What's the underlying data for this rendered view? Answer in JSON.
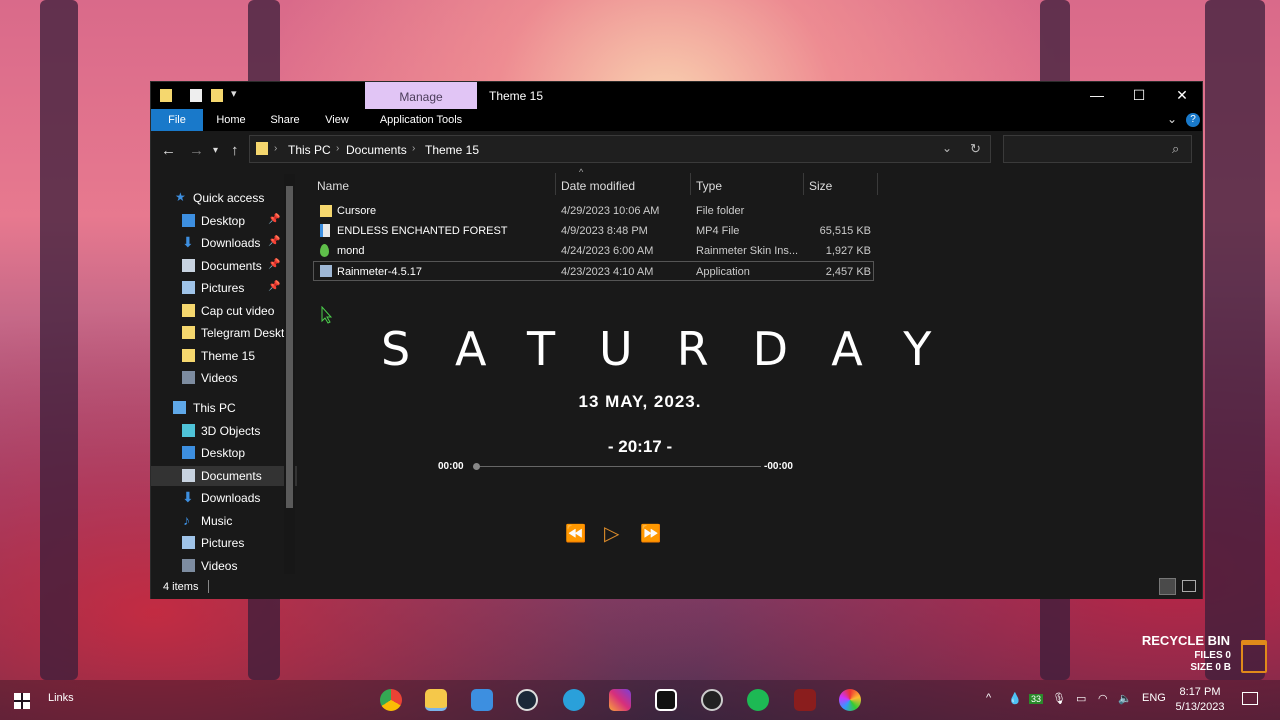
{
  "window": {
    "title": "Theme 15",
    "contextual_tab": "Manage",
    "controls": {
      "minimize": "—",
      "maximize": "☐",
      "close": "✕"
    }
  },
  "ribbon": {
    "tabs": [
      "File",
      "Home",
      "Share",
      "View",
      "Application Tools"
    ],
    "accent": "#1979ca"
  },
  "address": {
    "crumbs": [
      "This PC",
      "Documents",
      "Theme 15"
    ],
    "search_placeholder": ""
  },
  "nav": {
    "quick_access": "Quick access",
    "quick_items": [
      {
        "label": "Desktop",
        "pinned": true
      },
      {
        "label": "Downloads",
        "pinned": true
      },
      {
        "label": "Documents",
        "pinned": true
      },
      {
        "label": "Pictures",
        "pinned": true
      },
      {
        "label": "Cap cut video",
        "pinned": false
      },
      {
        "label": "Telegram Deskto",
        "pinned": false
      },
      {
        "label": "Theme 15",
        "pinned": false
      },
      {
        "label": "Videos",
        "pinned": false
      }
    ],
    "this_pc": "This PC",
    "pc_items": [
      "3D Objects",
      "Desktop",
      "Documents",
      "Downloads",
      "Music",
      "Pictures",
      "Videos"
    ],
    "selected": "Documents"
  },
  "files": {
    "columns": [
      "Name",
      "Date modified",
      "Type",
      "Size"
    ],
    "rows": [
      {
        "name": "Cursore",
        "date": "4/29/2023 10:06 AM",
        "type": "File folder",
        "size": ""
      },
      {
        "name": "ENDLESS ENCHANTED FOREST",
        "date": "4/9/2023 8:48 PM",
        "type": "MP4 File",
        "size": "65,515 KB"
      },
      {
        "name": "mond",
        "date": "4/24/2023 6:00 AM",
        "type": "Rainmeter Skin Ins...",
        "size": "1,927 KB"
      },
      {
        "name": "Rainmeter-4.5.17",
        "date": "4/23/2023 4:10 AM",
        "type": "Application",
        "size": "2,457 KB"
      }
    ]
  },
  "status": {
    "count": "4 items"
  },
  "widget": {
    "day": "SATURDAY",
    "date": "13  MAY,  2023.",
    "time": "- 20:17 -",
    "elapsed": "00:00",
    "remaining": "-00:00",
    "position": 0,
    "controls": {
      "prev": "⏪",
      "play": "▷",
      "next": "⏩"
    },
    "accent": "#d98a2a"
  },
  "recycle": {
    "title": "RECYCLE BIN",
    "files": "FILES 0",
    "size": "SIZE 0 B"
  },
  "taskbar": {
    "links": "Links",
    "lang": "ENG",
    "time": "8:17 PM",
    "date": "5/13/2023",
    "tray_badge": "33"
  }
}
